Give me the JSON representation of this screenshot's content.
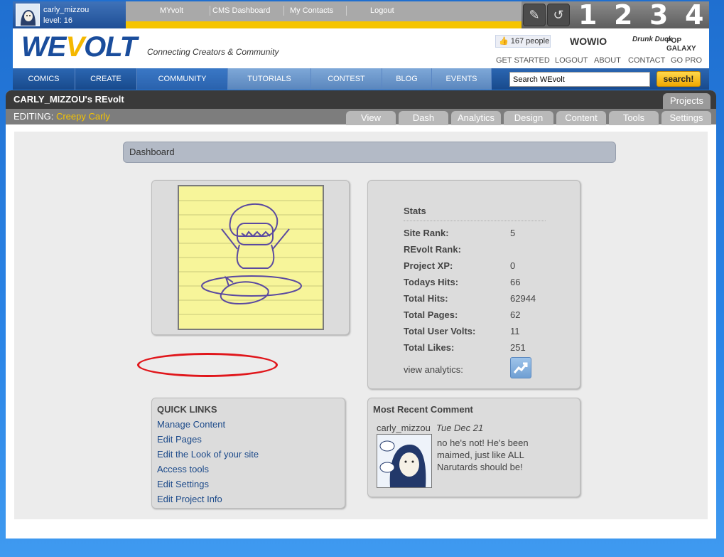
{
  "user": {
    "name": "carly_mizzou",
    "level": "level: 16"
  },
  "top_nav": [
    "MYvolt",
    "CMS Dashboard",
    "My Contacts",
    "Logout"
  ],
  "top_numbers": [
    "1",
    "2",
    "3",
    "4"
  ],
  "logo": {
    "we": "WE",
    "v": "V",
    "olt": "OLT"
  },
  "tagline": "Connecting Creators & Community",
  "like_count": "167 people",
  "partners": [
    "WOWIO",
    "Drunk Duck",
    "POP GALAXY"
  ],
  "header_links": [
    "GET STARTED",
    "LOGOUT",
    "ABOUT",
    "CONTACT",
    "GO PRO"
  ],
  "main_nav": [
    "COMICS",
    "CREATE",
    "COMMUNITY",
    "TUTORIALS",
    "CONTEST",
    "BLOG",
    "EVENTS"
  ],
  "search": {
    "value": "Search WEvolt",
    "button": "search!"
  },
  "panel": {
    "title": "CARLY_MIZZOU's REvolt",
    "projects_button": "Projects",
    "editing_label": "EDITING:",
    "project_name": "Creepy Carly",
    "tabs": [
      "View",
      "Dash",
      "Analytics",
      "Design",
      "Content",
      "Tools",
      "Settings"
    ]
  },
  "dashboard_title": "Dashboard",
  "stats": {
    "heading": "Stats",
    "rows": [
      {
        "label": "Site Rank:",
        "value": "5"
      },
      {
        "label": "REvolt Rank:",
        "value": ""
      },
      {
        "label": "Project XP:",
        "value": "0"
      },
      {
        "label": "Todays Hits:",
        "value": "66"
      },
      {
        "label": "Total Hits:",
        "value": "62944"
      },
      {
        "label": "Total Pages:",
        "value": "62"
      },
      {
        "label": "Total User Volts:",
        "value": "11"
      },
      {
        "label": "Total Likes:",
        "value": "251"
      }
    ],
    "view_analytics": "view analytics:"
  },
  "quick_links": {
    "heading": "QUICK LINKS",
    "items": [
      "Manage Content",
      "Edit Pages",
      "Edit the Look of your site",
      "Access tools",
      "Edit Settings",
      "Edit Project Info"
    ]
  },
  "recent_comment": {
    "heading": "Most Recent Comment",
    "user": "carly_mizzou",
    "date": "Tue Dec 21",
    "text": "no he's not! He's been maimed, just like ALL Narutards should be!"
  },
  "colors": {
    "brand_blue": "#1a4d9c",
    "accent_yellow": "#f5c400",
    "highlight_red": "#e0161b"
  }
}
